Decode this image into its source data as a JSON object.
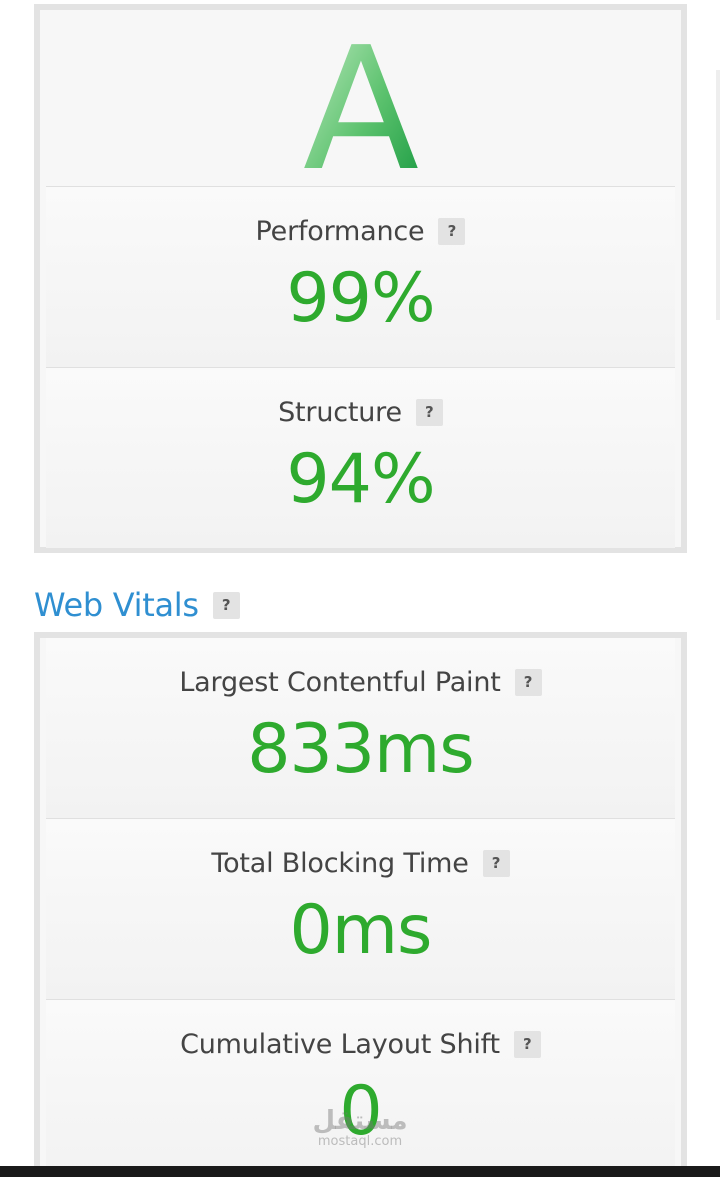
{
  "grade": {
    "letter": "A",
    "colors": {
      "light": "#b9e6b9",
      "dark": "#1f9e45"
    }
  },
  "scores": [
    {
      "label": "Performance",
      "value": "99%",
      "help": "?"
    },
    {
      "label": "Structure",
      "value": "94%",
      "help": "?"
    }
  ],
  "web_vitals": {
    "title": "Web Vitals",
    "help": "?",
    "items": [
      {
        "label": "Largest Contentful Paint",
        "value": "833ms",
        "help": "?"
      },
      {
        "label": "Total Blocking Time",
        "value": "0ms",
        "help": "?"
      },
      {
        "label": "Cumulative Layout Shift",
        "value": "0",
        "help": "?"
      }
    ]
  },
  "watermark": {
    "main": "مستقل",
    "sub": "mostaql.com"
  },
  "colors": {
    "value_green": "#2eaa2e",
    "heading_blue": "#2f8fd1",
    "card_border": "#e3e3e3"
  }
}
